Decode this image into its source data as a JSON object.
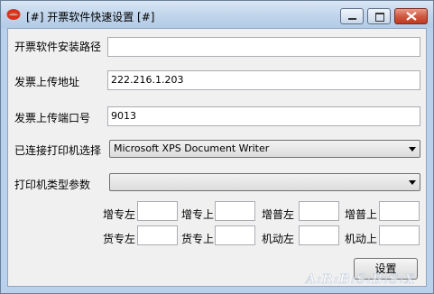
{
  "window": {
    "title": "[#] 开票软件快速设置 [#]",
    "icon": "red-lips-app-icon"
  },
  "form": {
    "install_path_label": "开票软件安装路径",
    "install_path_value": "",
    "upload_address_label": "发票上传地址",
    "upload_address_value": "222.216.1.203",
    "upload_port_label": "发票上传端口号",
    "upload_port_value": "9013",
    "printer_label": "已连接打印机选择",
    "printer_value": "Microsoft XPS Document Writer",
    "print_type_label": "打印机类型参数",
    "print_type_value": ""
  },
  "offsets": {
    "row1": [
      {
        "label": "增专左",
        "value": ""
      },
      {
        "label": "增专上",
        "value": ""
      },
      {
        "label": "增普左",
        "value": ""
      },
      {
        "label": "增普上",
        "value": ""
      }
    ],
    "row2": [
      {
        "label": "货专左",
        "value": ""
      },
      {
        "label": "货专上",
        "value": ""
      },
      {
        "label": "机动左",
        "value": ""
      },
      {
        "label": "机动上",
        "value": ""
      }
    ]
  },
  "buttons": {
    "settings_label": "设置"
  },
  "colors": {
    "title_gradient_top": "#d9e6f4",
    "close_button": "#c0391f",
    "client_background": "#f0f0f0"
  }
}
